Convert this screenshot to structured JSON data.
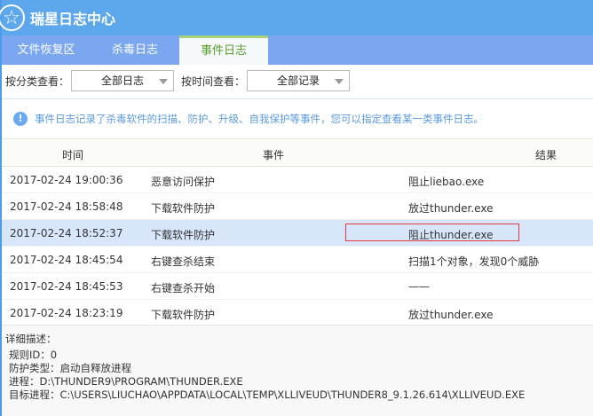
{
  "app": {
    "title": "瑞星日志中心",
    "logo_icon": "star-icon"
  },
  "tabs": [
    {
      "label": "文件恢复区"
    },
    {
      "label": "杀毒日志"
    },
    {
      "label": "事件日志",
      "active": true
    }
  ],
  "filters": {
    "category_label": "按分类查看：",
    "category_value": "全部日志",
    "time_label": "按时间查看：",
    "time_value": "全部记录"
  },
  "info": {
    "text": "事件日志记录了杀毒软件的扫描、防护、升级、自我保护等事件，您可以指定查看某一类事件日志。"
  },
  "table": {
    "headers": [
      "时间",
      "事件",
      "结果"
    ],
    "rows": [
      {
        "time": "2017-02-24 19:00:36",
        "event": "恶意访问保护",
        "result": "阻止liebao.exe"
      },
      {
        "time": "2017-02-24 18:58:48",
        "event": "下载软件防护",
        "result": "放过thunder.exe"
      },
      {
        "time": "2017-02-24 18:52:37",
        "event": "下载软件防护",
        "result": "阻止thunder.exe",
        "selected": true
      },
      {
        "time": "2017-02-24 18:45:54",
        "event": "右键查杀结束",
        "result": "扫描1个对象，发现0个威胁"
      },
      {
        "time": "2017-02-24 18:45:53",
        "event": "右键查杀开始",
        "result": "——"
      },
      {
        "time": "2017-02-24 18:23:19",
        "event": "下载软件防护",
        "result": "放过thunder.exe"
      }
    ]
  },
  "detail": {
    "label": "详细描述：",
    "lines": [
      "规则ID：0",
      "防护类型：启动自释放进程",
      "进程：D:\\THUNDER9\\PROGRAM\\THUNDER.EXE",
      "目标进程：C:\\USERS\\LIUCHAO\\APPDATA\\LOCAL\\TEMP\\XLLIVEUD\\THUNDER8_9.1.26.614\\XLLIVEUD.EXE"
    ]
  }
}
